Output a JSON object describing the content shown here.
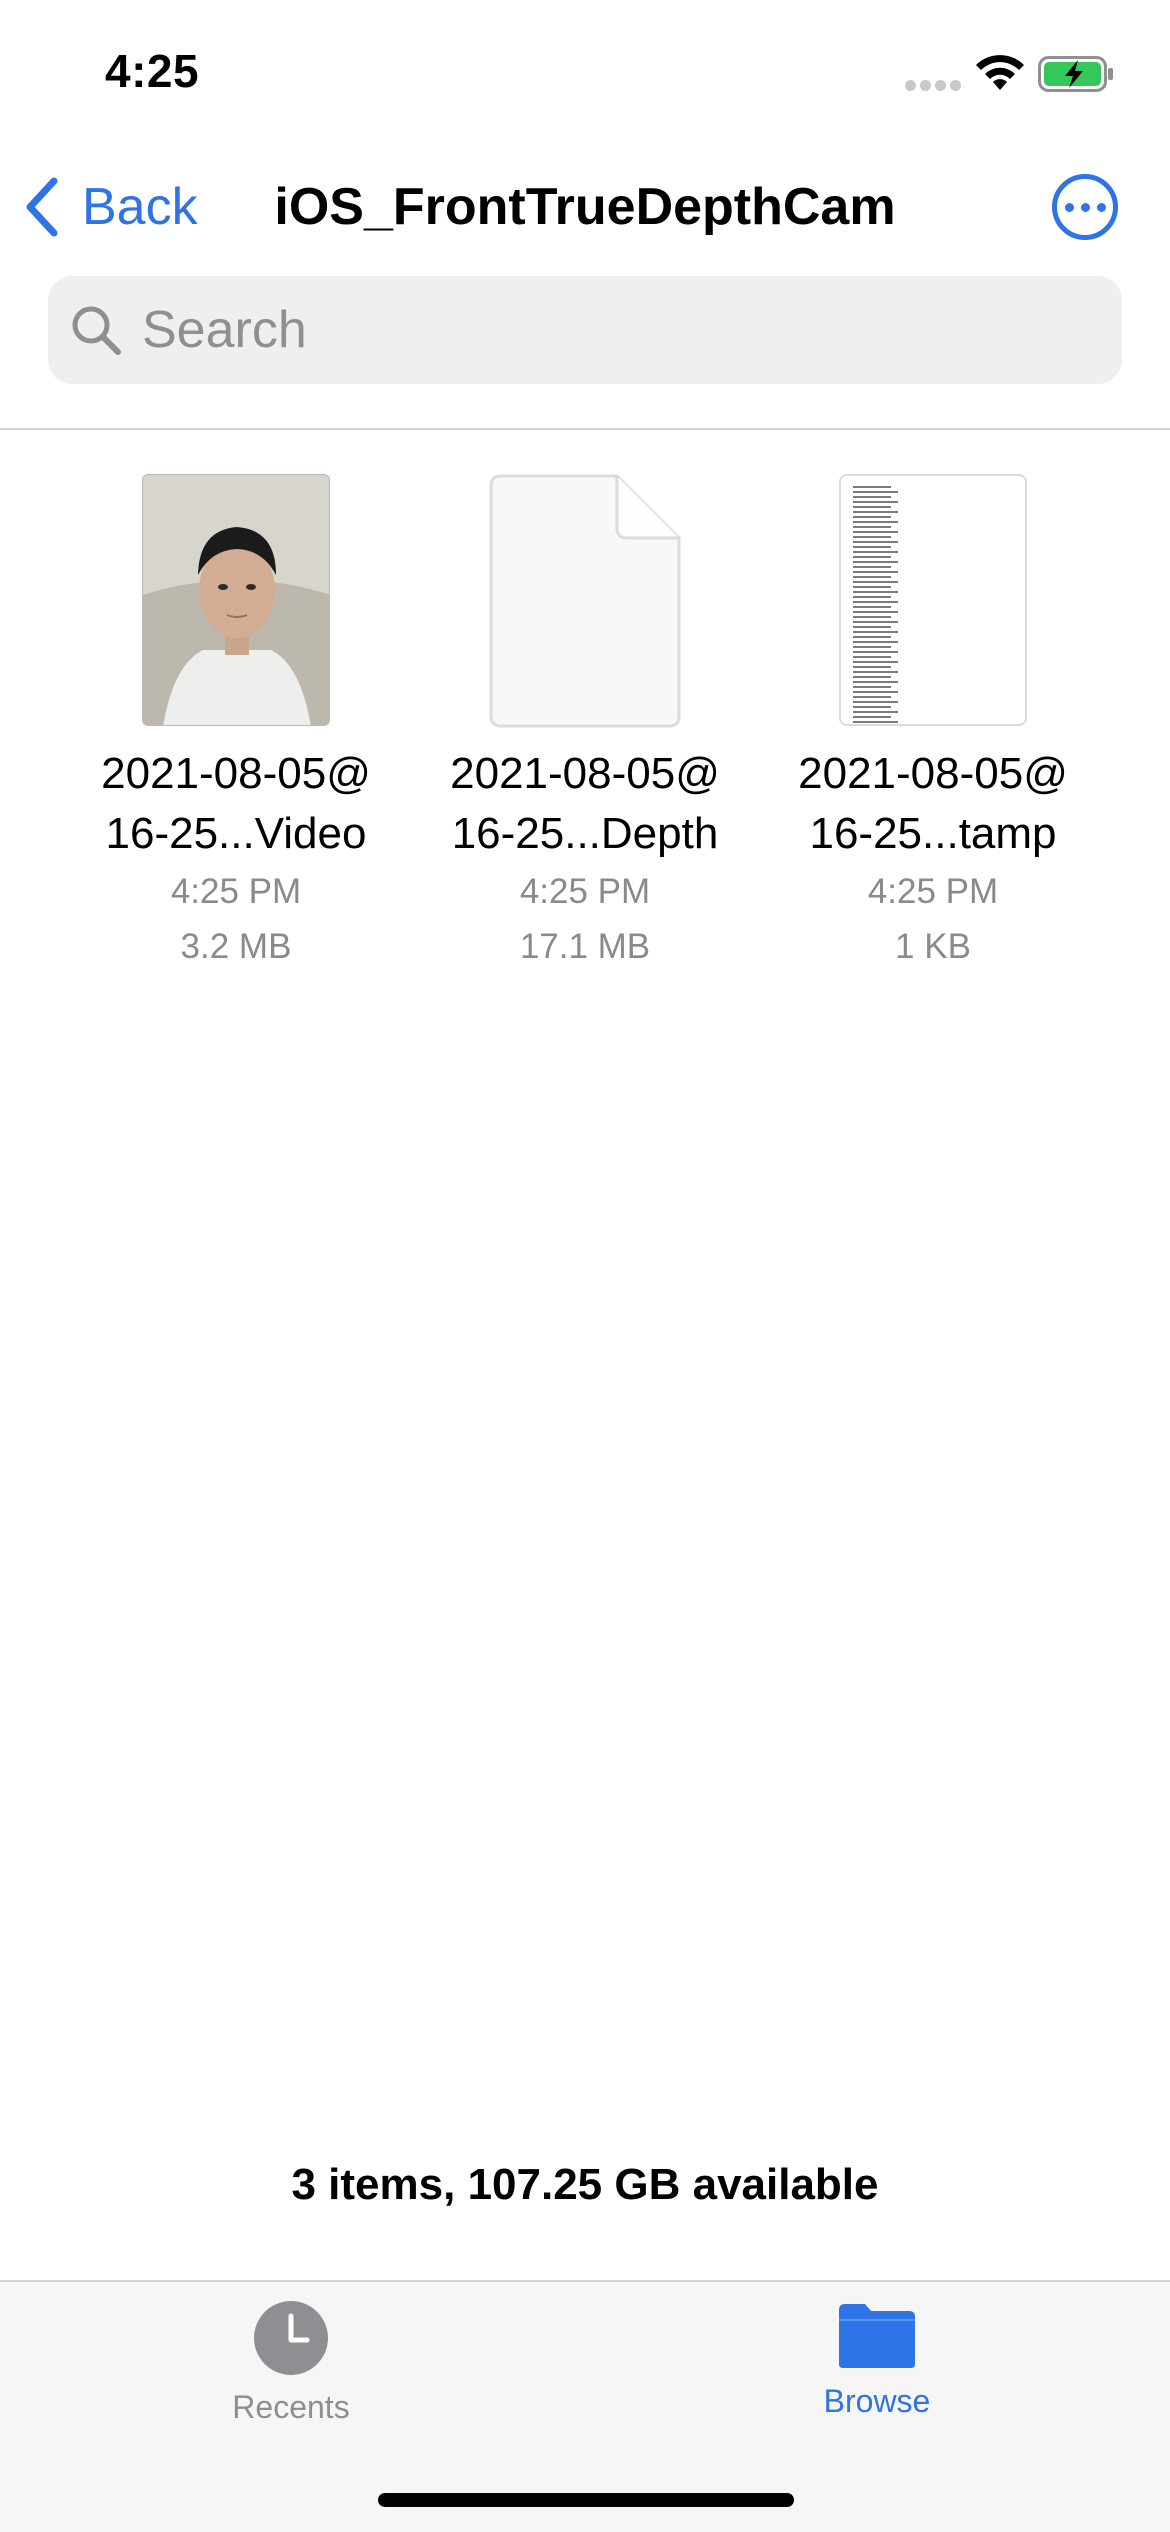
{
  "status_bar": {
    "time": "4:25",
    "icons": [
      "cellular-signal-icon",
      "wifi-icon",
      "battery-charging-icon"
    ],
    "battery_color": "#34c759"
  },
  "nav": {
    "back_label": "Back",
    "title": "iOS_FrontTrueDepthCam",
    "more_icon": "ellipsis-circle-icon"
  },
  "search": {
    "placeholder": "Search",
    "icon": "magnifying-glass-icon"
  },
  "files": [
    {
      "name_line1": "2021-08-05@",
      "name_line2": "16-25...Video",
      "time": "4:25 PM",
      "size": "3.2 MB",
      "thumbnail": "video-frame-portrait"
    },
    {
      "name_line1": "2021-08-05@",
      "name_line2": "16-25...Depth",
      "time": "4:25 PM",
      "size": "17.1 MB",
      "thumbnail": "blank-document-icon"
    },
    {
      "name_line1": "2021-08-05@",
      "name_line2": "16-25...tamp",
      "time": "4:25 PM",
      "size": "1 KB",
      "thumbnail": "text-document-preview"
    }
  ],
  "footer": {
    "info": "3 items, 107.25 GB available"
  },
  "tabs": [
    {
      "label": "Recents",
      "icon": "clock-icon",
      "selected": false
    },
    {
      "label": "Browse",
      "icon": "folder-icon",
      "selected": true
    }
  ],
  "colors": {
    "accent": "#2f74e6",
    "secondary_text": "#8a8a8e",
    "search_bg": "#efeff0",
    "tab_bar_bg": "#f6f6f6"
  }
}
